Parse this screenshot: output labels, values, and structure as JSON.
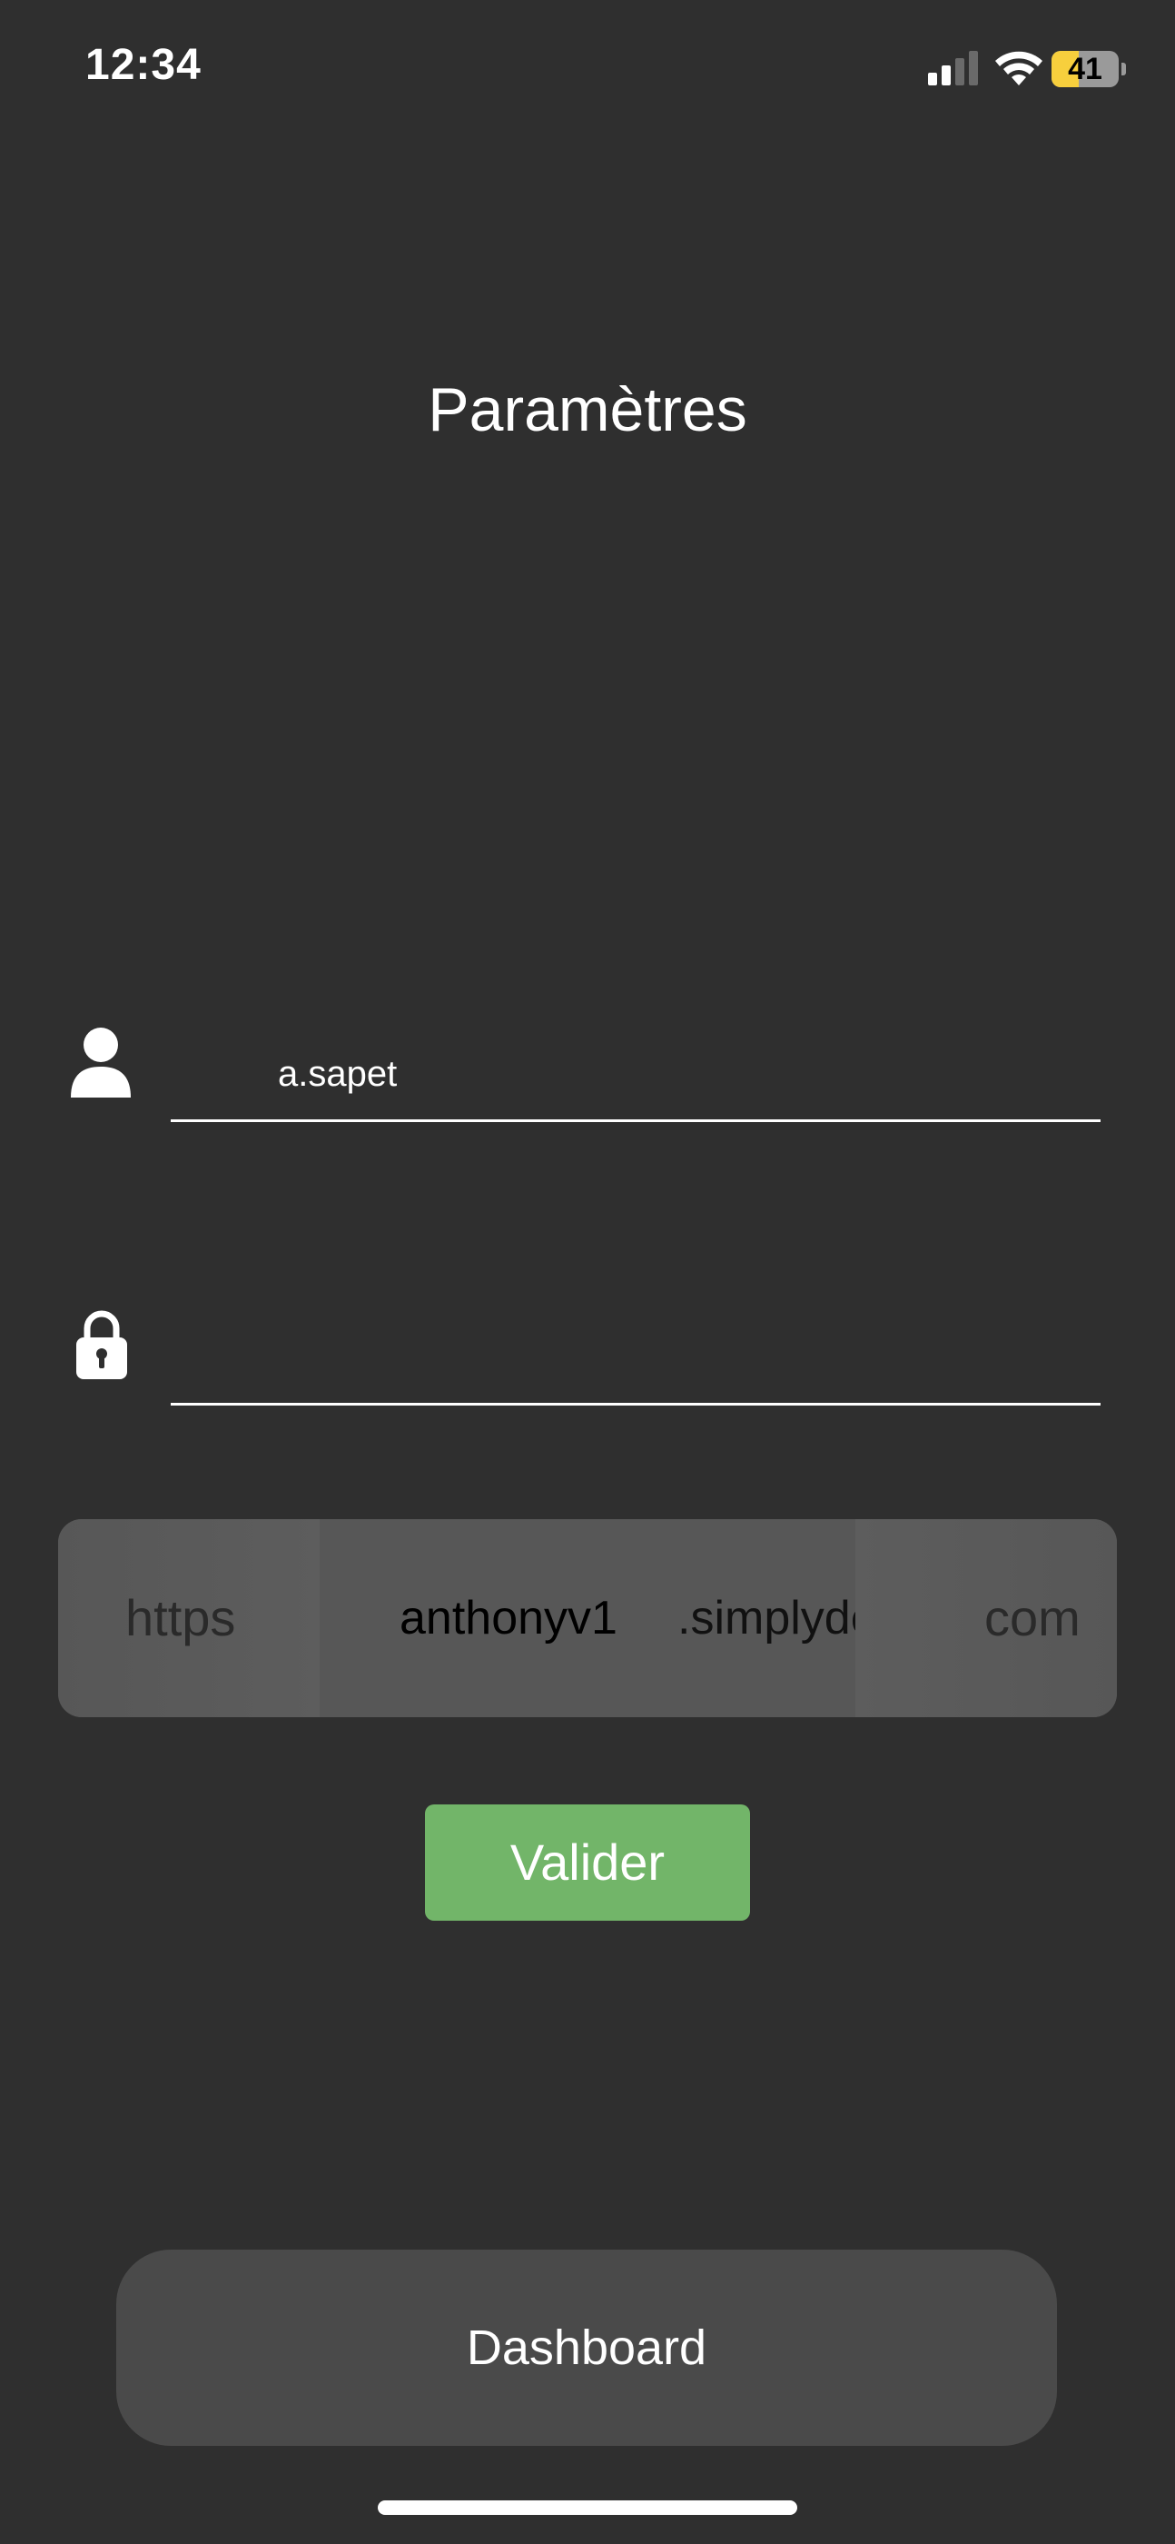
{
  "status_bar": {
    "time": "12:34",
    "signal_icon": "cellular-signal-icon",
    "wifi_icon": "wifi-icon",
    "battery_level": "41",
    "battery_fraction": 0.41,
    "battery_color": "#f7cf3d"
  },
  "header": {
    "title": "Paramètres"
  },
  "form": {
    "username": {
      "icon": "user-icon",
      "value": "a.sapet"
    },
    "password": {
      "icon": "lock-icon",
      "value": ""
    },
    "url": {
      "scheme": "https",
      "subdomain": "anthonyv1",
      "domain": ".simplydesk.",
      "tld": "com"
    },
    "validate_label": "Valider",
    "validate_color": "#72b569"
  },
  "footer": {
    "dashboard_label": "Dashboard"
  },
  "colors": {
    "background": "#2f2f2f",
    "url_bar": "#575757",
    "dashboard_button": "#4a4a4a"
  }
}
